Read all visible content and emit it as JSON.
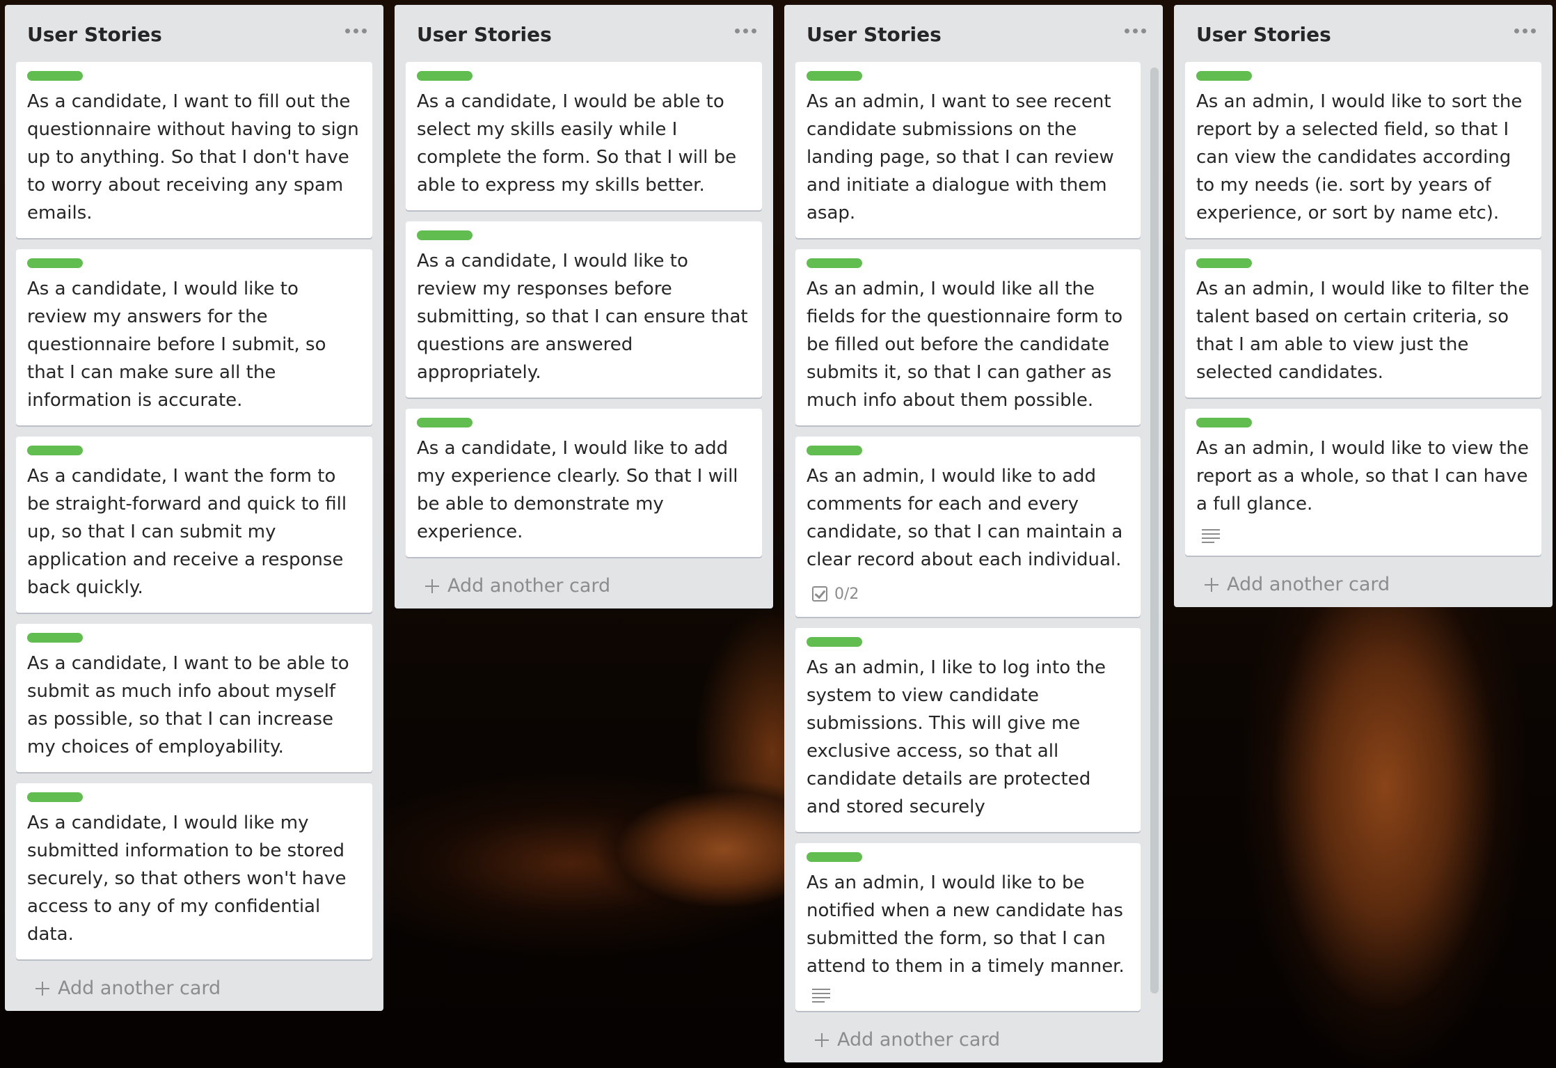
{
  "lists": [
    {
      "title": "User Stories",
      "add_label": "Add another card",
      "cards": [
        {
          "label": "green",
          "text": "As a candidate, I want to fill out the questionnaire without having to sign up to anything. So that I don't have to worry about receiving any spam emails."
        },
        {
          "label": "green",
          "text": "As a candidate, I would like to review my answers for the questionnaire before I submit, so that I can make sure all the information is accurate."
        },
        {
          "label": "green",
          "text": "As a candidate, I want the form to be straight-forward and quick to fill up, so that I can submit my application and receive a response back quickly."
        },
        {
          "label": "green",
          "text": "As a candidate, I want to be able to submit as much info about myself as possible, so that I can increase my choices of employability."
        },
        {
          "label": "green",
          "text": "As a candidate, I would like my submitted information to be stored securely, so that others won't have access to any of my confidential data."
        }
      ]
    },
    {
      "title": "User Stories",
      "add_label": "Add another card",
      "cards": [
        {
          "label": "green",
          "text": "As a candidate, I would be able to select my skills easily while I complete the form. So that I will be able to express my skills better."
        },
        {
          "label": "green",
          "text": "As a candidate, I would like to review my responses before submitting, so that I can ensure that questions are answered appropriately."
        },
        {
          "label": "green",
          "text": "As a candidate, I would like to add my experience clearly. So that I will be able to demonstrate my experience."
        }
      ]
    },
    {
      "title": "User Stories",
      "add_label": "Add another card",
      "cards": [
        {
          "label": "green",
          "text": "As an admin, I want to see recent candidate submissions on the landing page, so that I can review and initiate a dialogue with them asap."
        },
        {
          "label": "green",
          "text": "As an admin, I would like all the fields for the questionnaire form to be filled out before the candidate submits it, so that I can gather as much info about them possible."
        },
        {
          "label": "green",
          "text": "As an admin, I would like to add comments for each and every candidate, so that I can maintain a clear record about each individual.",
          "checklist": "0/2"
        },
        {
          "label": "green",
          "text": "As an admin, I like to log into the system to view candidate submissions. This will give me exclusive access, so that all candidate details are protected and stored securely"
        },
        {
          "label": "green",
          "text": "As an admin, I would like to be notified when a new candidate has submitted the form, so that I can attend to them in a timely manner.",
          "description": true
        }
      ]
    },
    {
      "title": "User Stories",
      "add_label": "Add another card",
      "cards": [
        {
          "label": "green",
          "text": "As an admin, I would like to sort the report by a selected field, so that I can view the candidates according to my needs (ie. sort by years of experience, or sort by name etc)."
        },
        {
          "label": "green",
          "text": "As an admin, I would like to filter the talent based on certain criteria, so that I am able to view just the selected candidates."
        },
        {
          "label": "green",
          "text": "As an admin, I would like to view the report as a whole, so that I can have a full glance.",
          "description": true
        }
      ]
    }
  ]
}
